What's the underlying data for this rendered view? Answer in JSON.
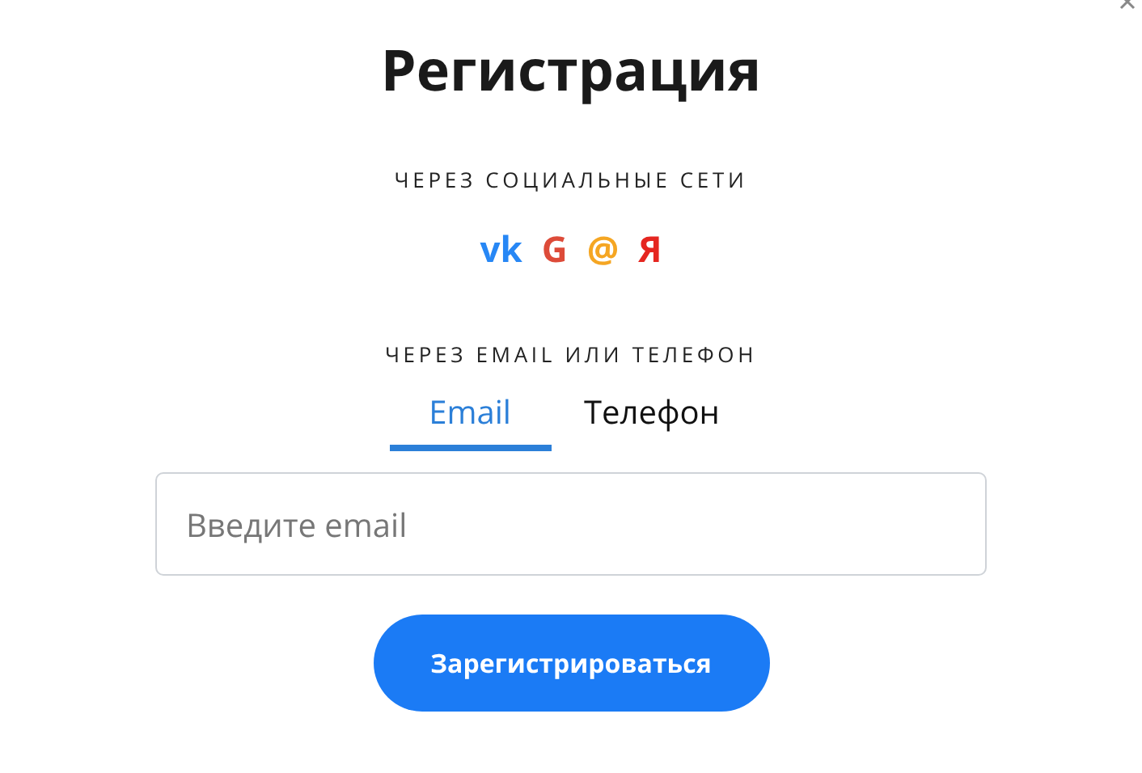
{
  "title": "Регистрация",
  "social_heading": "ЧЕРЕЗ СОЦИАЛЬНЫЕ СЕТИ",
  "social": [
    {
      "label": "vk",
      "color": "#2787f5"
    },
    {
      "label": "G",
      "color": "#dd4b39"
    },
    {
      "label": "@",
      "color": "#f5a623"
    },
    {
      "label": "Я",
      "color": "#e52620"
    }
  ],
  "contact_heading": "ЧЕРЕЗ EMAIL ИЛИ ТЕЛЕФОН",
  "tabs": [
    {
      "label": "Email",
      "selected": true
    },
    {
      "label": "Телефон",
      "selected": false
    }
  ],
  "email_field": {
    "placeholder": "Введите email"
  },
  "submit_button": "Зарегистрироваться"
}
